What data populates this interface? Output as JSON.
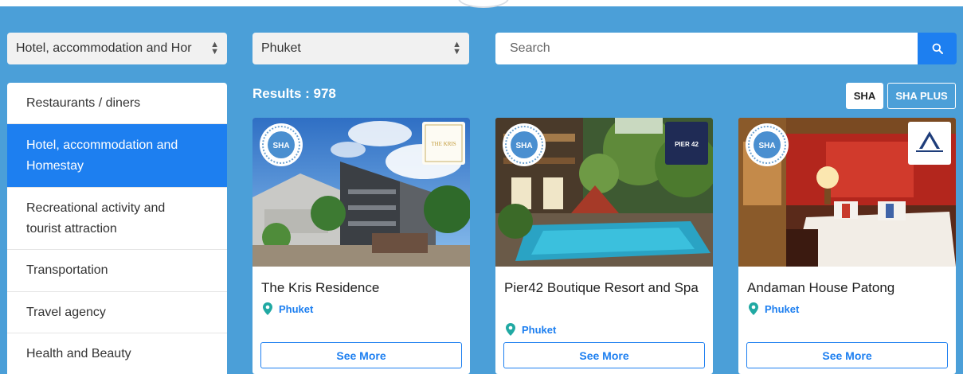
{
  "filters": {
    "category_value": "Hotel, accommodation and Hor",
    "province_value": "Phuket"
  },
  "search": {
    "placeholder": "Search"
  },
  "sidebar": {
    "items": [
      {
        "label": "Restaurants / diners",
        "active": false
      },
      {
        "label": "Hotel, accommodation and Homestay",
        "active": true
      },
      {
        "label": "Recreational activity and tourist attraction",
        "active": false
      },
      {
        "label": "Transportation",
        "active": false
      },
      {
        "label": "Travel agency",
        "active": false
      },
      {
        "label": "Health and Beauty",
        "active": false
      }
    ]
  },
  "results": {
    "label": "Results : 978"
  },
  "toggles": {
    "sha": "SHA",
    "sha_plus": "SHA PLUS"
  },
  "badge_text": "SHA",
  "cards": [
    {
      "name": "The Kris Residence",
      "location": "Phuket",
      "button": "See More",
      "partner_text": "THE KRIS"
    },
    {
      "name": "Pier42 Boutique Resort and Spa",
      "location": "Phuket",
      "button": "See More",
      "partner_text": "PIER 42"
    },
    {
      "name": "Andaman House Patong",
      "location": "Phuket",
      "button": "See More",
      "partner_text": ""
    }
  ],
  "colors": {
    "background": "#4b9fd8",
    "accent": "#1d7ff0",
    "pin": "#21a9a3"
  }
}
